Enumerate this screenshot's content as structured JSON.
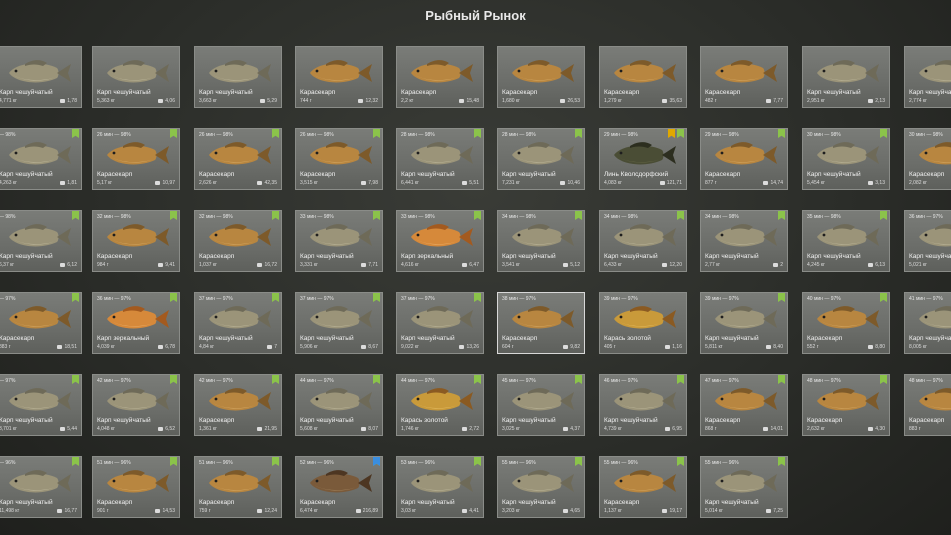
{
  "header": {
    "title": "Рыбный Рынок"
  },
  "rows": [
    {
      "time": "",
      "cards": [
        {
          "name": "Карп чешуйчатый",
          "weight": "4,771 кг",
          "price": "1,78",
          "fish": "mirror-carp",
          "flags": []
        },
        {
          "name": "Карп чешуйчатый",
          "weight": "5,363 кг",
          "price": "4,06",
          "fish": "mirror-carp",
          "flags": []
        },
        {
          "name": "Карп чешуйчатый",
          "weight": "3,663 кг",
          "price": "5,29",
          "fish": "mirror-carp",
          "flags": []
        },
        {
          "name": "Карасекарп",
          "weight": "744 г",
          "price": "12,32",
          "fish": "golden-carp",
          "flags": []
        },
        {
          "name": "Карасекарп",
          "weight": "2,2 кг",
          "price": "15,48",
          "fish": "golden-carp",
          "flags": []
        },
        {
          "name": "Карасекарп",
          "weight": "1,680 кг",
          "price": "26,53",
          "fish": "golden-carp",
          "flags": []
        },
        {
          "name": "Карасекарп",
          "weight": "1,279 кг",
          "price": "35,63",
          "fish": "golden-carp",
          "flags": []
        },
        {
          "name": "Карасекарп",
          "weight": "482 г",
          "price": "7,77",
          "fish": "golden-carp",
          "flags": []
        },
        {
          "name": "Карп чешуйчатый",
          "weight": "2,951 кг",
          "price": "2,13",
          "fish": "mirror-carp",
          "flags": []
        },
        {
          "name": "Карп чешуйчатый",
          "weight": "2,774 кг",
          "price": "",
          "fish": "mirror-carp",
          "flags": []
        }
      ]
    },
    {
      "time": "98%",
      "cards": [
        {
          "time": "— 98%",
          "name": "Карп чешуйчатый",
          "weight": "4,263 кг",
          "price": "1,81",
          "fish": "mirror-carp",
          "flags": [
            "green"
          ]
        },
        {
          "time": "26 мин — 98%",
          "name": "Карасекарп",
          "weight": "5,17 кг",
          "price": "10,97",
          "fish": "golden-carp",
          "flags": [
            "green"
          ]
        },
        {
          "time": "26 мин — 98%",
          "name": "Карасекарп",
          "weight": "2,626 кг",
          "price": "42,35",
          "fish": "golden-carp",
          "flags": [
            "green"
          ]
        },
        {
          "time": "26 мин — 98%",
          "name": "Карасекарп",
          "weight": "3,515 кг",
          "price": "7,98",
          "fish": "golden-carp",
          "flags": [
            "green"
          ]
        },
        {
          "time": "28 мин — 98%",
          "name": "Карп чешуйчатый",
          "weight": "6,441 кг",
          "price": "5,51",
          "fish": "mirror-carp",
          "flags": [
            "green"
          ]
        },
        {
          "time": "28 мин — 98%",
          "name": "Карп чешуйчатый",
          "weight": "7,231 кг",
          "price": "10,46",
          "fish": "mirror-carp",
          "flags": [
            "green"
          ]
        },
        {
          "time": "29 мин — 98%",
          "name": "Линь Кволсдорфский",
          "weight": "4,083 кг",
          "price": "121,71",
          "fish": "tench",
          "flags": [
            "green",
            "gold"
          ]
        },
        {
          "time": "29 мин — 98%",
          "name": "Карасекарп",
          "weight": "877 г",
          "price": "14,74",
          "fish": "golden-carp",
          "flags": [
            "green"
          ]
        },
        {
          "time": "30 мин — 98%",
          "name": "Карп чешуйчатый",
          "weight": "5,454 кг",
          "price": "3,13",
          "fish": "mirror-carp",
          "flags": [
            "green"
          ]
        },
        {
          "time": "30 мин — 98%",
          "name": "Карасекарп",
          "weight": "2,082 кг",
          "price": "",
          "fish": "golden-carp",
          "flags": [
            "green"
          ]
        }
      ]
    },
    {
      "cards": [
        {
          "time": "— 98%",
          "name": "Карп чешуйчатый",
          "weight": "6,37 кг",
          "price": "6,12",
          "fish": "mirror-carp",
          "flags": [
            "green"
          ]
        },
        {
          "time": "32 мин — 98%",
          "name": "Карасекарп",
          "weight": "984 г",
          "price": "9,41",
          "fish": "golden-carp",
          "flags": [
            "green"
          ]
        },
        {
          "time": "32 мин — 98%",
          "name": "Карасекарп",
          "weight": "1,037 кг",
          "price": "16,72",
          "fish": "golden-carp",
          "flags": [
            "green"
          ]
        },
        {
          "time": "33 мин — 98%",
          "name": "Карп чешуйчатый",
          "weight": "3,331 кг",
          "price": "7,71",
          "fish": "mirror-carp",
          "flags": [
            "green"
          ]
        },
        {
          "time": "33 мин — 98%",
          "name": "Карп зеркальный",
          "weight": "4,616 кг",
          "price": "6,47",
          "fish": "orange-carp",
          "flags": [
            "green"
          ]
        },
        {
          "time": "34 мин — 98%",
          "name": "Карп чешуйчатый",
          "weight": "3,541 кг",
          "price": "5,12",
          "fish": "mirror-carp",
          "flags": [
            "green"
          ]
        },
        {
          "time": "34 мин — 98%",
          "name": "Карп чешуйчатый",
          "weight": "6,433 кг",
          "price": "12,20",
          "fish": "mirror-carp",
          "flags": [
            "green"
          ]
        },
        {
          "time": "34 мин — 98%",
          "name": "Карп чешуйчатый",
          "weight": "2,77 кг",
          "price": "2",
          "fish": "mirror-carp",
          "flags": [
            "green"
          ]
        },
        {
          "time": "35 мин — 98%",
          "name": "Карп чешуйчатый",
          "weight": "4,245 кг",
          "price": "6,13",
          "fish": "mirror-carp",
          "flags": [
            "green"
          ]
        },
        {
          "time": "36 мин — 97%",
          "name": "Карп чешуйчатый",
          "weight": "5,021 кг",
          "price": "",
          "fish": "mirror-carp",
          "flags": [
            "green"
          ]
        }
      ]
    },
    {
      "cards": [
        {
          "time": "— 97%",
          "name": "Карасекарп",
          "weight": "883 г",
          "price": "18,51",
          "fish": "golden-carp",
          "flags": [
            "green"
          ]
        },
        {
          "time": "36 мин — 97%",
          "name": "Карп зеркальный",
          "weight": "4,039 кг",
          "price": "6,78",
          "fish": "orange-carp",
          "flags": [
            "green"
          ]
        },
        {
          "time": "37 мин — 97%",
          "name": "Карп чешуйчатый",
          "weight": "4,84 кг",
          "price": "7",
          "fish": "mirror-carp",
          "flags": [
            "green"
          ]
        },
        {
          "time": "37 мин — 97%",
          "name": "Карп чешуйчатый",
          "weight": "5,906 кг",
          "price": "8,67",
          "fish": "mirror-carp",
          "flags": [
            "green"
          ]
        },
        {
          "time": "37 мин — 97%",
          "name": "Карп чешуйчатый",
          "weight": "9,022 кг",
          "price": "13,26",
          "fish": "mirror-carp",
          "flags": [
            "green"
          ]
        },
        {
          "time": "38 мин — 97%",
          "name": "Карасекарп",
          "weight": "604 г",
          "price": "9,82",
          "fish": "golden-carp",
          "flags": [],
          "selected": true
        },
        {
          "time": "39 мин — 97%",
          "name": "Карась золотой",
          "weight": "405 г",
          "price": "1,16",
          "fish": "crucian",
          "flags": []
        },
        {
          "time": "39 мин — 97%",
          "name": "Карп чешуйчатый",
          "weight": "5,811 кг",
          "price": "8,40",
          "fish": "mirror-carp",
          "flags": [
            "green"
          ]
        },
        {
          "time": "40 мин — 97%",
          "name": "Карасекарп",
          "weight": "552 г",
          "price": "8,80",
          "fish": "golden-carp",
          "flags": [
            "green"
          ]
        },
        {
          "time": "41 мин — 97%",
          "name": "Карп чешуйчатый",
          "weight": "8,005 кг",
          "price": "",
          "fish": "mirror-carp",
          "flags": [
            "green"
          ]
        }
      ]
    },
    {
      "cards": [
        {
          "time": "— 97%",
          "name": "Карп чешуйчатый",
          "weight": "3,701 кг",
          "price": "5,44",
          "fish": "mirror-carp",
          "flags": [
            "green"
          ]
        },
        {
          "time": "42 мин — 97%",
          "name": "Карп чешуйчатый",
          "weight": "4,048 кг",
          "price": "6,52",
          "fish": "mirror-carp",
          "flags": [
            "green"
          ]
        },
        {
          "time": "42 мин — 97%",
          "name": "Карасекарп",
          "weight": "1,361 кг",
          "price": "21,95",
          "fish": "golden-carp",
          "flags": [
            "green"
          ]
        },
        {
          "time": "44 мин — 97%",
          "name": "Карп чешуйчатый",
          "weight": "5,608 кг",
          "price": "8,07",
          "fish": "mirror-carp",
          "flags": [
            "green"
          ]
        },
        {
          "time": "44 мин — 97%",
          "name": "Карась золотой",
          "weight": "1,746 кг",
          "price": "2,72",
          "fish": "crucian",
          "flags": [
            "green"
          ]
        },
        {
          "time": "45 мин — 97%",
          "name": "Карп чешуйчатый",
          "weight": "3,025 кг",
          "price": "4,37",
          "fish": "mirror-carp",
          "flags": [
            "green"
          ]
        },
        {
          "time": "46 мин — 97%",
          "name": "Карп чешуйчатый",
          "weight": "4,739 кг",
          "price": "6,95",
          "fish": "mirror-carp",
          "flags": [
            "green"
          ]
        },
        {
          "time": "47 мин — 97%",
          "name": "Карасекарп",
          "weight": "868 г",
          "price": "14,01",
          "fish": "golden-carp",
          "flags": [
            "green"
          ]
        },
        {
          "time": "48 мин — 97%",
          "name": "Карасекарп",
          "weight": "2,632 кг",
          "price": "4,30",
          "fish": "golden-carp",
          "flags": [
            "green"
          ]
        },
        {
          "time": "48 мин — 97%",
          "name": "Карасекарп",
          "weight": "883 г",
          "price": "",
          "fish": "golden-carp",
          "flags": [
            "green"
          ]
        }
      ]
    },
    {
      "cards": [
        {
          "time": "— 96%",
          "name": "Карп чешуйчатый",
          "weight": "11,498 кг",
          "price": "16,77",
          "fish": "mirror-carp",
          "flags": [
            "green"
          ]
        },
        {
          "time": "51 мин — 96%",
          "name": "Карасекарп",
          "weight": "901 г",
          "price": "14,53",
          "fish": "golden-carp",
          "flags": [
            "green"
          ]
        },
        {
          "time": "51 мин — 96%",
          "name": "Карасекарп",
          "weight": "759 г",
          "price": "12,24",
          "fish": "golden-carp",
          "flags": [
            "green"
          ]
        },
        {
          "time": "52 мин — 96%",
          "name": "Карасекарп",
          "weight": "6,474 кг",
          "price": "216,89",
          "fish": "bronze-carp",
          "flags": [
            "green",
            "blue"
          ]
        },
        {
          "time": "53 мин — 96%",
          "name": "Карп чешуйчатый",
          "weight": "3,03 кг",
          "price": "4,41",
          "fish": "mirror-carp",
          "flags": [
            "green"
          ]
        },
        {
          "time": "55 мин — 96%",
          "name": "Карп чешуйчатый",
          "weight": "3,203 кг",
          "price": "4,65",
          "fish": "mirror-carp",
          "flags": [
            "green"
          ]
        },
        {
          "time": "55 мин — 96%",
          "name": "Карасекарп",
          "weight": "1,137 кг",
          "price": "19,17",
          "fish": "golden-carp",
          "flags": [
            "green"
          ]
        },
        {
          "time": "55 мин — 96%",
          "name": "Карп чешуйчатый",
          "weight": "5,014 кг",
          "price": "7,25",
          "fish": "mirror-carp",
          "flags": [
            "green"
          ]
        }
      ]
    }
  ]
}
